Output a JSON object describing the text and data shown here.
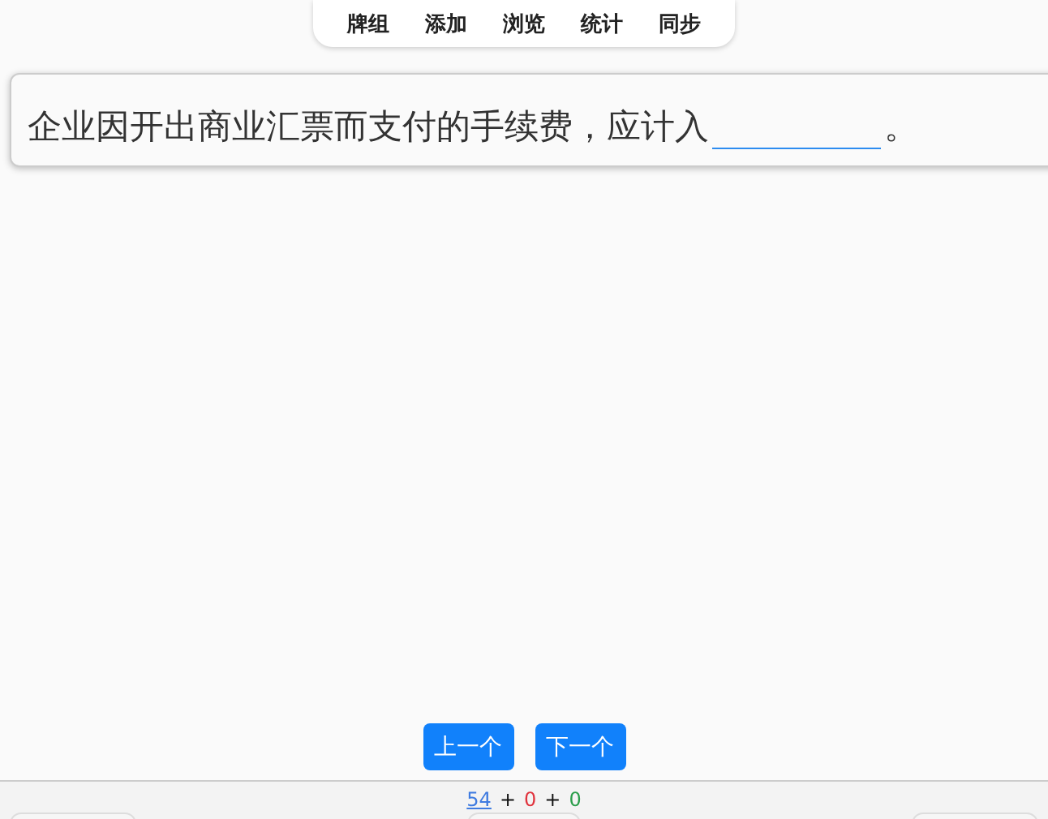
{
  "nav": {
    "tabs": [
      {
        "label": "牌组"
      },
      {
        "label": "添加"
      },
      {
        "label": "浏览"
      },
      {
        "label": "统计"
      },
      {
        "label": "同步"
      }
    ]
  },
  "card": {
    "question_before": "企业因开出商业汇票而支付的手续费，应计入",
    "question_after": "。"
  },
  "buttons": [
    {
      "label": "上一个"
    },
    {
      "label": "下一个"
    }
  ],
  "footer": {
    "counts": [
      {
        "value": "54",
        "color": "#3f7be0",
        "link": true
      },
      {
        "value": "0",
        "color": "#e0323c",
        "link": false
      },
      {
        "value": "0",
        "color": "#2a9d4a",
        "link": false
      }
    ],
    "separators": [
      "+",
      "+"
    ]
  }
}
